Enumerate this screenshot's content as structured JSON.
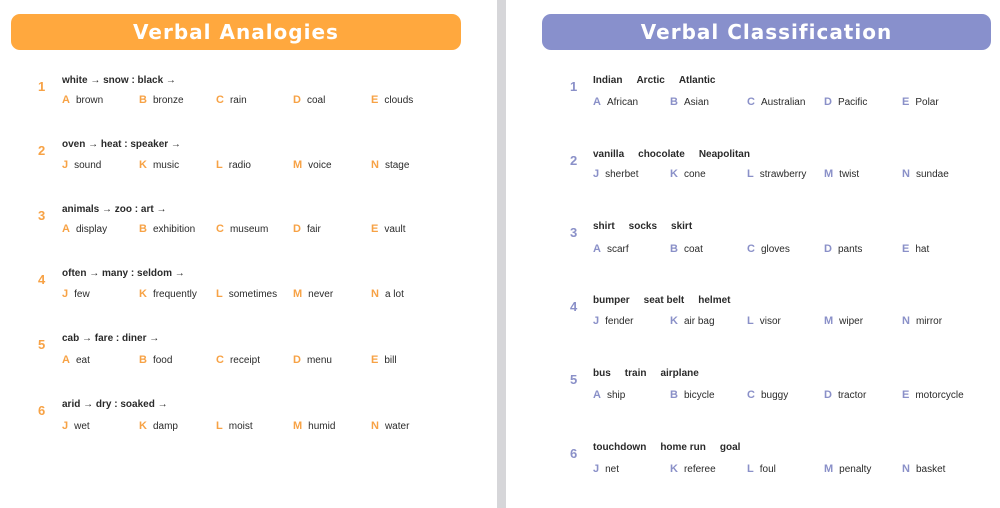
{
  "left": {
    "title": "Verbal Analogies",
    "accent": "#ffa83e",
    "questions": [
      {
        "number": "1",
        "prompt": "white → snow : black →",
        "options": [
          [
            "A",
            "brown"
          ],
          [
            "B",
            "bronze"
          ],
          [
            "C",
            "rain"
          ],
          [
            "D",
            "coal"
          ],
          [
            "E",
            "clouds"
          ]
        ]
      },
      {
        "number": "2",
        "prompt": "oven → heat : speaker →",
        "options": [
          [
            "J",
            "sound"
          ],
          [
            "K",
            "music"
          ],
          [
            "L",
            "radio"
          ],
          [
            "M",
            "voice"
          ],
          [
            "N",
            "stage"
          ]
        ]
      },
      {
        "number": "3",
        "prompt": "animals → zoo : art →",
        "options": [
          [
            "A",
            "display"
          ],
          [
            "B",
            "exhibition"
          ],
          [
            "C",
            "museum"
          ],
          [
            "D",
            "fair"
          ],
          [
            "E",
            "vault"
          ]
        ]
      },
      {
        "number": "4",
        "prompt": "often → many : seldom →",
        "options": [
          [
            "J",
            "few"
          ],
          [
            "K",
            "frequently"
          ],
          [
            "L",
            "sometimes"
          ],
          [
            "M",
            "never"
          ],
          [
            "N",
            "a lot"
          ]
        ]
      },
      {
        "number": "5",
        "prompt": "cab → fare : diner →",
        "options": [
          [
            "A",
            "eat"
          ],
          [
            "B",
            "food"
          ],
          [
            "C",
            "receipt"
          ],
          [
            "D",
            "menu"
          ],
          [
            "E",
            "bill"
          ]
        ]
      },
      {
        "number": "6",
        "prompt": "arid → dry : soaked →",
        "options": [
          [
            "J",
            "wet"
          ],
          [
            "K",
            "damp"
          ],
          [
            "L",
            "moist"
          ],
          [
            "M",
            "humid"
          ],
          [
            "N",
            "water"
          ]
        ]
      }
    ]
  },
  "right": {
    "title": "Verbal Classification",
    "accent": "#8890cc",
    "questions": [
      {
        "number": "1",
        "words": [
          "Indian",
          "Arctic",
          "Atlantic"
        ],
        "options": [
          [
            "A",
            "African"
          ],
          [
            "B",
            "Asian"
          ],
          [
            "C",
            "Australian"
          ],
          [
            "D",
            "Pacific"
          ],
          [
            "E",
            "Polar"
          ]
        ]
      },
      {
        "number": "2",
        "words": [
          "vanilla",
          "chocolate",
          "Neapolitan"
        ],
        "options": [
          [
            "J",
            "sherbet"
          ],
          [
            "K",
            "cone"
          ],
          [
            "L",
            "strawberry"
          ],
          [
            "M",
            "twist"
          ],
          [
            "N",
            "sundae"
          ]
        ]
      },
      {
        "number": "3",
        "words": [
          "shirt",
          "socks",
          "skirt"
        ],
        "options": [
          [
            "A",
            "scarf"
          ],
          [
            "B",
            "coat"
          ],
          [
            "C",
            "gloves"
          ],
          [
            "D",
            "pants"
          ],
          [
            "E",
            "hat"
          ]
        ]
      },
      {
        "number": "4",
        "words": [
          "bumper",
          "seat belt",
          "helmet"
        ],
        "options": [
          [
            "J",
            "fender"
          ],
          [
            "K",
            "air bag"
          ],
          [
            "L",
            "visor"
          ],
          [
            "M",
            "wiper"
          ],
          [
            "N",
            "mirror"
          ]
        ]
      },
      {
        "number": "5",
        "words": [
          "bus",
          "train",
          "airplane"
        ],
        "options": [
          [
            "A",
            "ship"
          ],
          [
            "B",
            "bicycle"
          ],
          [
            "C",
            "buggy"
          ],
          [
            "D",
            "tractor"
          ],
          [
            "E",
            "motorcycle"
          ]
        ]
      },
      {
        "number": "6",
        "words": [
          "touchdown",
          "home run",
          "goal"
        ],
        "options": [
          [
            "J",
            "net"
          ],
          [
            "K",
            "referee"
          ],
          [
            "L",
            "foul"
          ],
          [
            "M",
            "penalty"
          ],
          [
            "N",
            "basket"
          ]
        ]
      }
    ]
  }
}
